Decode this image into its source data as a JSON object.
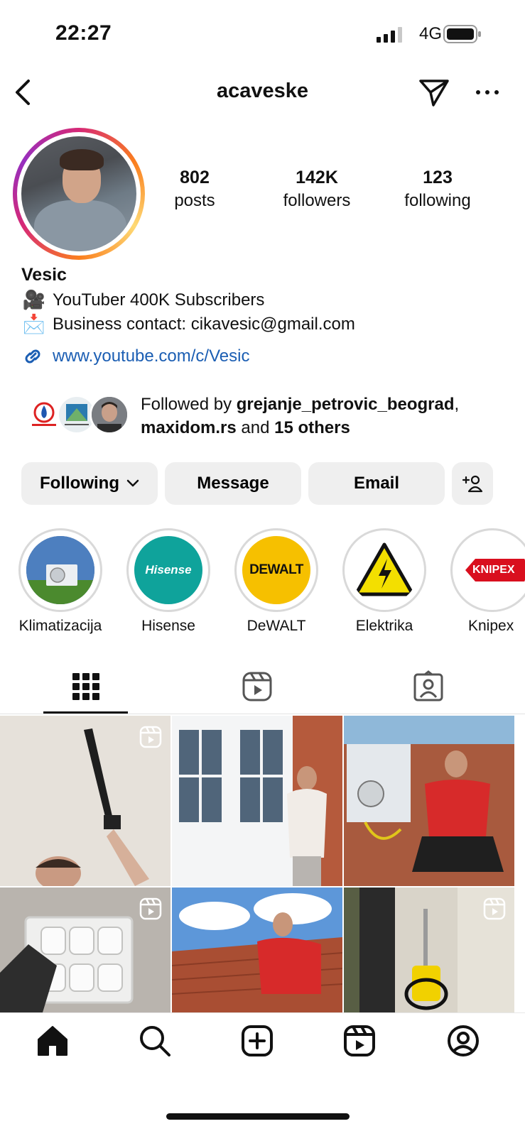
{
  "status_bar": {
    "time": "22:27",
    "network": "4G"
  },
  "header": {
    "username": "acaveske"
  },
  "stats": [
    {
      "value": "802",
      "label": "posts"
    },
    {
      "value": "142K",
      "label": "followers"
    },
    {
      "value": "123",
      "label": "following"
    }
  ],
  "bio": {
    "name": "Vesic",
    "line1": "YouTuber 400K Subscribers",
    "line2": "Business contact: cikavesic@gmail.com",
    "link": "www.youtube.com/c/Vesic",
    "line1_emoji": "🎥",
    "line2_emoji": "📩"
  },
  "followed_by": {
    "prefix": "Followed by ",
    "user1": "grejanje_petrovic_beograd",
    "sep": ",",
    "user2": "maxidom.rs",
    "and": " and ",
    "others": "15 others"
  },
  "actions": {
    "following": "Following",
    "message": "Message",
    "email": "Email"
  },
  "highlights": [
    {
      "label": "Klimatizacija"
    },
    {
      "label": "Hisense",
      "logo_text": "Hisense"
    },
    {
      "label": "DeWALT",
      "logo_text": "DEWALT"
    },
    {
      "label": "Elektrika"
    },
    {
      "label": "Knipex",
      "logo_text": "KNIPEX"
    }
  ],
  "colors": {
    "link": "#1b5eb3",
    "button_bg": "#efefef",
    "hisense": "#0fa39b",
    "dewalt": "#f6c000"
  },
  "icons": {
    "back": "chevron-left-icon",
    "send": "direct-message-icon",
    "more": "more-icon",
    "tabs": [
      "grid-icon",
      "reels-icon",
      "tagged-icon"
    ],
    "nav": [
      "home-icon",
      "search-icon",
      "new-post-icon",
      "reels-icon",
      "profile-icon"
    ]
  }
}
